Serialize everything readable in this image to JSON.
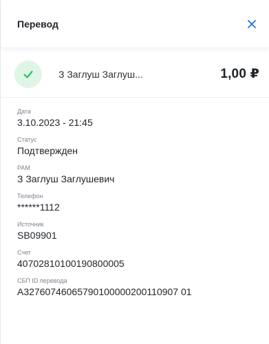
{
  "header": {
    "title": "Перевод"
  },
  "summary": {
    "recipient": "З Заглуш Заглуш...",
    "amount": "1,00 ₽"
  },
  "fields": [
    {
      "label": "Дата",
      "value": "3.10.2023 - 21:45"
    },
    {
      "label": "Статус",
      "value": "Подтвержден"
    },
    {
      "label": "РАМ",
      "value": "З Заглуш Заглушевич"
    },
    {
      "label": "Телефон",
      "value": "******1112"
    },
    {
      "label": "Источник",
      "value": "SB09901"
    },
    {
      "label": "Счет",
      "value": "40702810100190800005"
    },
    {
      "label": "СБП ID перевода",
      "value": "A32760746065790100000200110907 01"
    }
  ],
  "colors": {
    "accent": "#1e73d8",
    "success": "#2fbf61",
    "success_bg": "#dff6e7"
  },
  "icons": {
    "close": "close-icon",
    "status": "check-icon"
  }
}
